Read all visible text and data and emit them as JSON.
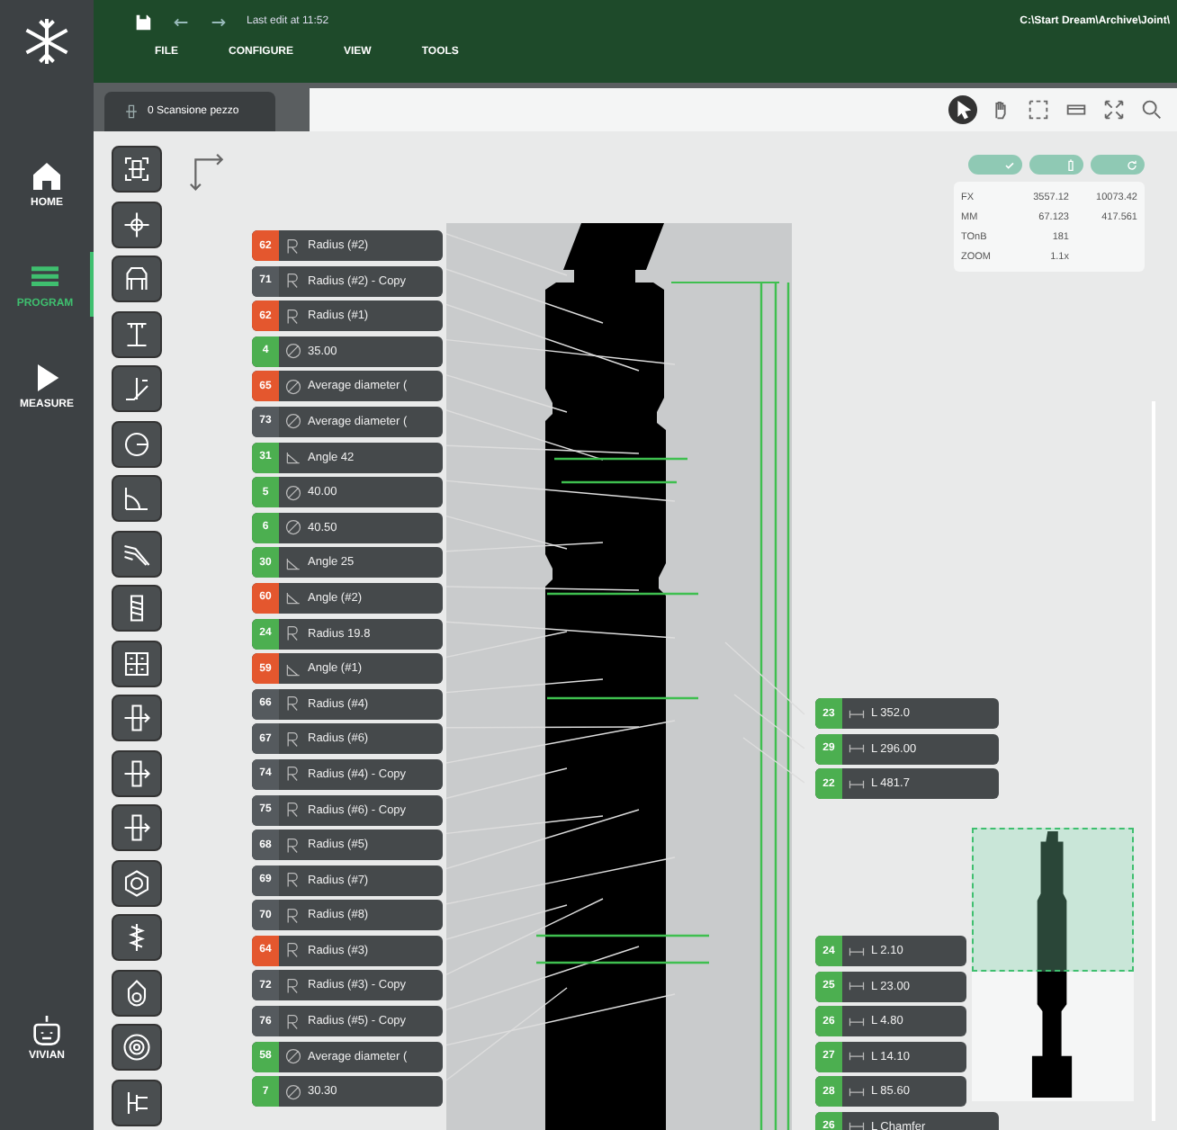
{
  "topbar": {
    "last_edit": "Last edit at 11:52",
    "path": "C:\\Start Dream\\Archive\\Joint\\",
    "menu": [
      "FILE",
      "CONFIGURE",
      "VIEW",
      "TOOLS"
    ]
  },
  "nav": [
    {
      "label": "HOME",
      "kind": "home",
      "selected": false
    },
    {
      "label": "PROGRAM",
      "kind": "program",
      "selected": true
    },
    {
      "label": "MEASURE",
      "kind": "measure",
      "selected": false
    }
  ],
  "assistant": {
    "label": "VIVIAN"
  },
  "tabs": [
    {
      "label": "0 Scansione pezzo",
      "selected": true
    }
  ],
  "view_tools": [
    {
      "kind": "pointer",
      "selected": true
    },
    {
      "kind": "hand",
      "selected": false
    },
    {
      "kind": "select",
      "selected": false
    },
    {
      "kind": "rect",
      "selected": false
    },
    {
      "kind": "fit",
      "selected": false
    },
    {
      "kind": "search",
      "selected": false
    }
  ],
  "tools": [
    {
      "kind": "fit"
    },
    {
      "kind": "target"
    },
    {
      "kind": "gauge"
    },
    {
      "kind": "height"
    },
    {
      "kind": "chamfer"
    },
    {
      "kind": "circle"
    },
    {
      "kind": "angle"
    },
    {
      "kind": "profile"
    },
    {
      "kind": "thread"
    },
    {
      "kind": "grid"
    },
    {
      "kind": "rotate"
    },
    {
      "kind": "rotate"
    },
    {
      "kind": "rotate"
    },
    {
      "kind": "nut"
    },
    {
      "kind": "spring"
    },
    {
      "kind": "ring"
    },
    {
      "kind": "gear"
    },
    {
      "kind": "step"
    }
  ],
  "info": {
    "rows": [
      [
        "FX",
        "3557.12",
        "10073.42"
      ],
      [
        "MM",
        "67.123",
        "417.561"
      ],
      [
        "TOnB",
        "181"
      ],
      [
        "ZOOM",
        "1.1x"
      ]
    ]
  },
  "features": [
    {
      "number": "62",
      "color": "#e4572e",
      "kind": "radius",
      "text": "Radius (#2)"
    },
    {
      "number": "71",
      "color": "#555a5e",
      "kind": "radius",
      "text": "Radius (#2) - Copy"
    },
    {
      "number": "62",
      "color": "#e4572e",
      "kind": "radius",
      "text": "Radius (#1)"
    },
    {
      "number": "4",
      "color": "#4caf50",
      "kind": "diameter",
      "text": "35.00"
    },
    {
      "number": "65",
      "color": "#e4572e",
      "kind": "diameter",
      "text": "Average diameter ("
    },
    {
      "number": "73",
      "color": "#555a5e",
      "kind": "diameter",
      "text": "Average diameter ("
    },
    {
      "number": "31",
      "color": "#4caf50",
      "kind": "angle",
      "text": "Angle 42"
    },
    {
      "number": "5",
      "color": "#4caf50",
      "kind": "diameter",
      "text": "40.00"
    },
    {
      "number": "6",
      "color": "#4caf50",
      "kind": "diameter",
      "text": "40.50"
    },
    {
      "number": "30",
      "color": "#4caf50",
      "kind": "angle",
      "text": "Angle 25"
    },
    {
      "number": "60",
      "color": "#e4572e",
      "kind": "angle",
      "text": "Angle (#2)"
    },
    {
      "number": "24",
      "color": "#4caf50",
      "kind": "radius",
      "text": "Radius 19.8"
    },
    {
      "number": "59",
      "color": "#e4572e",
      "kind": "angle",
      "text": "Angle (#1)"
    },
    {
      "number": "66",
      "color": "#555a5e",
      "kind": "radius",
      "text": "Radius (#4)"
    },
    {
      "number": "67",
      "color": "#555a5e",
      "kind": "radius",
      "text": "Radius (#6)"
    },
    {
      "number": "74",
      "color": "#555a5e",
      "kind": "radius",
      "text": "Radius (#4) - Copy"
    },
    {
      "number": "75",
      "color": "#555a5e",
      "kind": "radius",
      "text": "Radius (#6) - Copy"
    },
    {
      "number": "68",
      "color": "#555a5e",
      "kind": "radius",
      "text": "Radius (#5)"
    },
    {
      "number": "69",
      "color": "#555a5e",
      "kind": "radius",
      "text": "Radius (#7)"
    },
    {
      "number": "70",
      "color": "#555a5e",
      "kind": "radius",
      "text": "Radius (#8)"
    },
    {
      "number": "64",
      "color": "#e4572e",
      "kind": "radius",
      "text": "Radius (#3)"
    },
    {
      "number": "72",
      "color": "#555a5e",
      "kind": "radius",
      "text": "Radius (#3) - Copy"
    },
    {
      "number": "76",
      "color": "#555a5e",
      "kind": "radius",
      "text": "Radius (#5) - Copy"
    },
    {
      "number": "58",
      "color": "#4caf50",
      "kind": "diameter",
      "text": "Average diameter ("
    },
    {
      "number": "7",
      "color": "#4caf50",
      "kind": "diameter",
      "text": "30.30"
    }
  ],
  "lengths_top": [
    {
      "number": "23",
      "color": "#4caf50",
      "text": "L 352.0"
    },
    {
      "number": "29",
      "color": "#4caf50",
      "text": "L 296.00"
    },
    {
      "number": "22",
      "color": "#4caf50",
      "text": "L 481.7"
    }
  ],
  "lengths_bottom": [
    {
      "number": "24",
      "color": "#4caf50",
      "text": "L 2.10"
    },
    {
      "number": "25",
      "color": "#4caf50",
      "text": "L 23.00"
    },
    {
      "number": "26",
      "color": "#4caf50",
      "text": "L 4.80"
    },
    {
      "number": "27",
      "color": "#4caf50",
      "text": "L 14.10"
    },
    {
      "number": "28",
      "color": "#4caf50",
      "text": "L 85.60"
    },
    {
      "number": "26",
      "color": "#4caf50",
      "text": "L Chamfer"
    }
  ]
}
